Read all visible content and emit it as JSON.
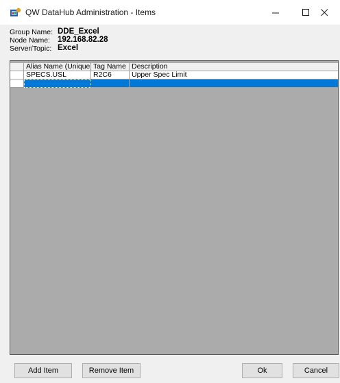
{
  "window": {
    "title": "QW DataHub Administration - Items"
  },
  "info": {
    "group_label": "Group Name:",
    "group_value": "DDE_Excel",
    "node_label": "Node Name:",
    "node_value": "192.168.82.28",
    "server_label": "Server/Topic:",
    "server_value": "Excel"
  },
  "grid": {
    "columns": [
      "Alias Name (Unique)",
      "Tag Name",
      "Description"
    ],
    "rows": [
      [
        "SPECS.USL",
        "R2C6",
        "Upper Spec Limit"
      ]
    ]
  },
  "buttons": {
    "add": "Add Item",
    "remove": "Remove Item",
    "ok": "Ok",
    "cancel": "Cancel"
  },
  "colors": {
    "selection": "#0078d7",
    "grid_background": "#ababab"
  }
}
